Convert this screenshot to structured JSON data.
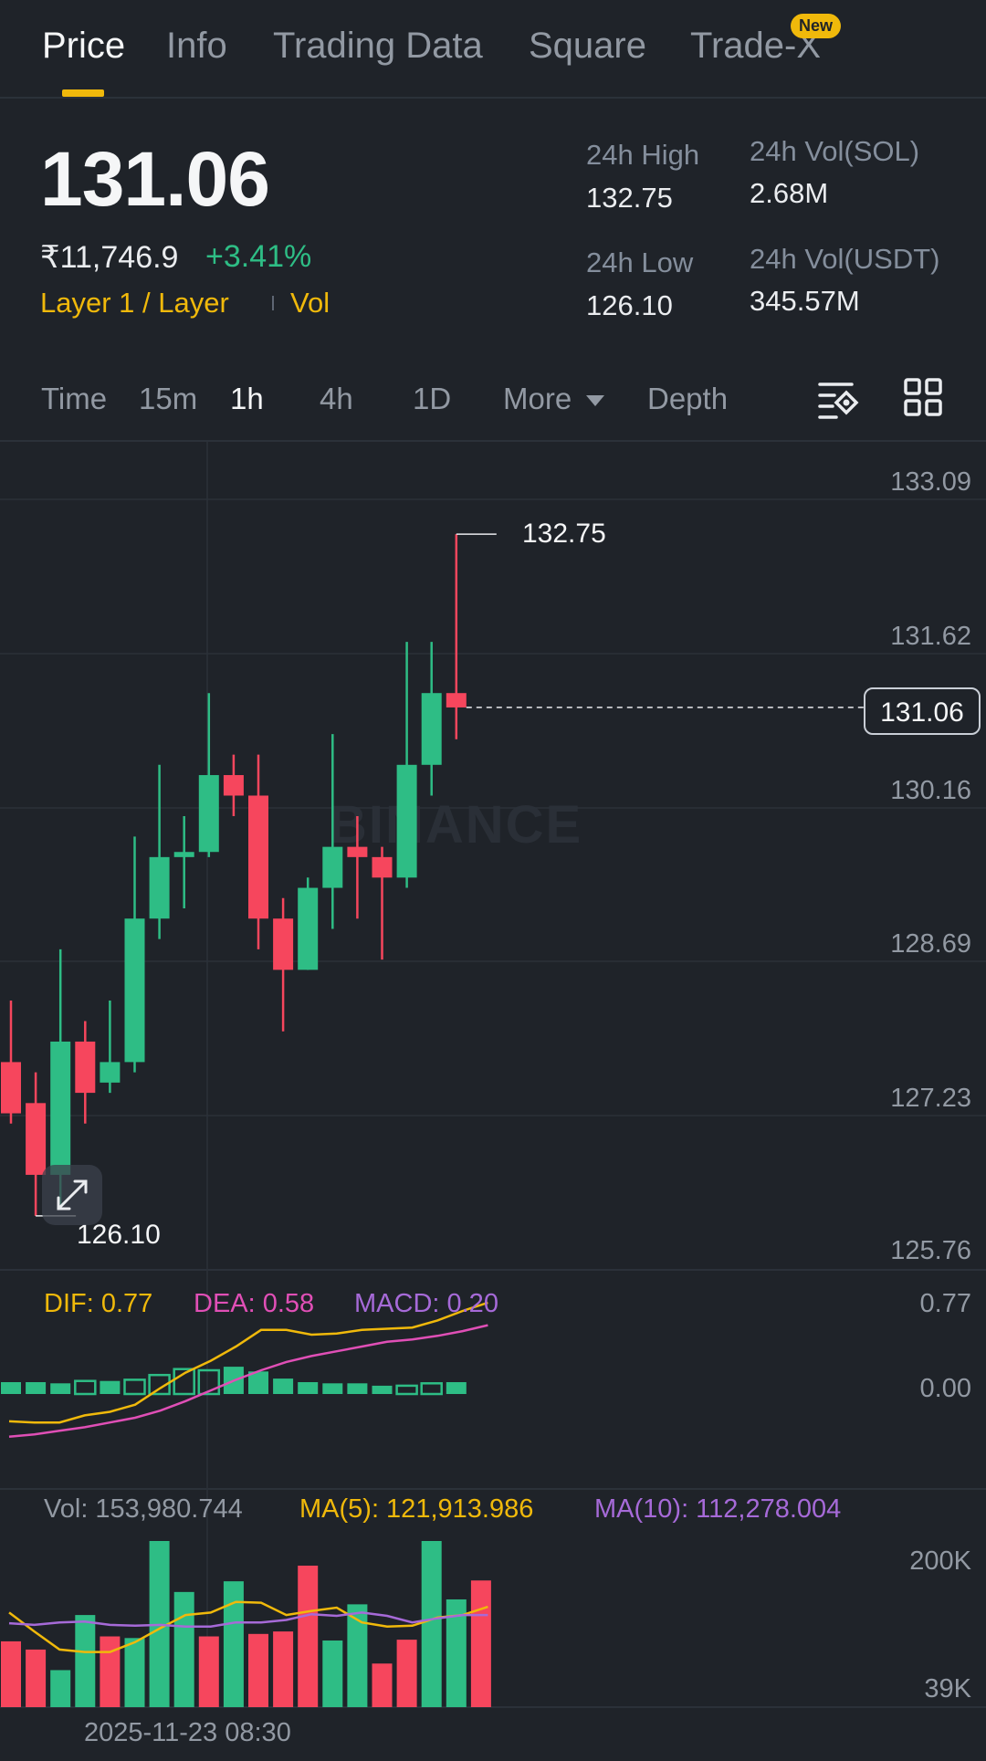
{
  "tabs": [
    {
      "label": "Price",
      "active": true
    },
    {
      "label": "Info",
      "active": false
    },
    {
      "label": "Trading Data",
      "active": false
    },
    {
      "label": "Square",
      "active": false
    },
    {
      "label": "Trade-X",
      "active": false,
      "badge": "New"
    }
  ],
  "summary": {
    "last_price": "131.06",
    "fiat_price": "₹11,746.9",
    "change_pct": "+3.41%",
    "tag_category": "Layer 1 / Layer",
    "tag_vol": "Vol"
  },
  "stats": {
    "high_label": "24h High",
    "high_value": "132.75",
    "low_label": "24h Low",
    "low_value": "126.10",
    "vol_base_label": "24h Vol(SOL)",
    "vol_base_value": "2.68M",
    "vol_quote_label": "24h Vol(USDT)",
    "vol_quote_value": "345.57M"
  },
  "timeframes": {
    "items": [
      "Time",
      "15m",
      "1h",
      "4h",
      "1D"
    ],
    "active": "1h",
    "more_label": "More",
    "depth_label": "Depth"
  },
  "icons": {
    "chart_settings": "chart-settings-icon",
    "layout_grid": "grid-layout-icon",
    "expand": "expand-icon",
    "more_caret": "caret-down-icon"
  },
  "colors": {
    "background": "#1f2329",
    "up": "#2ebd85",
    "down": "#f6465d",
    "accent": "#f0b90b",
    "dea": "#e04fb6",
    "macd": "#a66ad8"
  },
  "watermark": "BINANCE",
  "chart_data": [
    {
      "type": "candlestick",
      "y_ticks": [
        "133.09",
        "131.62",
        "130.16",
        "128.69",
        "127.23",
        "125.76"
      ],
      "ylim": [
        125.76,
        133.09
      ],
      "current_price_label": "131.06",
      "current_price": 131.06,
      "high_marker": {
        "label": "132.75",
        "value": 132.75
      },
      "low_marker": {
        "label": "126.10",
        "value": 126.1
      },
      "candles": [
        {
          "o": 127.6,
          "h": 128.2,
          "l": 127.0,
          "c": 127.1
        },
        {
          "o": 127.2,
          "h": 127.5,
          "l": 126.1,
          "c": 126.5
        },
        {
          "o": 126.5,
          "h": 128.7,
          "l": 126.2,
          "c": 127.8
        },
        {
          "o": 127.8,
          "h": 128.0,
          "l": 127.0,
          "c": 127.3
        },
        {
          "o": 127.4,
          "h": 128.2,
          "l": 127.3,
          "c": 127.6
        },
        {
          "o": 127.6,
          "h": 129.8,
          "l": 127.5,
          "c": 129.0
        },
        {
          "o": 129.0,
          "h": 130.5,
          "l": 128.8,
          "c": 129.6
        },
        {
          "o": 129.6,
          "h": 130.0,
          "l": 129.1,
          "c": 129.65
        },
        {
          "o": 129.65,
          "h": 131.2,
          "l": 129.6,
          "c": 130.4
        },
        {
          "o": 130.4,
          "h": 130.6,
          "l": 130.0,
          "c": 130.2
        },
        {
          "o": 130.2,
          "h": 130.6,
          "l": 128.7,
          "c": 129.0
        },
        {
          "o": 129.0,
          "h": 129.2,
          "l": 127.9,
          "c": 128.5
        },
        {
          "o": 128.5,
          "h": 129.4,
          "l": 128.5,
          "c": 129.3
        },
        {
          "o": 129.3,
          "h": 130.8,
          "l": 128.9,
          "c": 129.7
        },
        {
          "o": 129.7,
          "h": 130.0,
          "l": 129.0,
          "c": 129.6
        },
        {
          "o": 129.6,
          "h": 129.7,
          "l": 128.6,
          "c": 129.4
        },
        {
          "o": 129.4,
          "h": 131.7,
          "l": 129.3,
          "c": 130.5
        },
        {
          "o": 130.5,
          "h": 131.7,
          "l": 130.2,
          "c": 131.2
        },
        {
          "o": 131.2,
          "h": 132.75,
          "l": 130.75,
          "c": 131.06
        }
      ]
    },
    {
      "type": "bar",
      "indicator": "MACD",
      "legend": {
        "dif": "DIF: 0.77",
        "dea": "DEA: 0.58",
        "macd": "MACD: 0.20"
      },
      "y_ticks": [
        "0.77",
        "0.00"
      ],
      "histogram": [
        0.1,
        0.1,
        0.09,
        0.11,
        0.11,
        0.12,
        0.16,
        0.21,
        0.2,
        0.23,
        0.19,
        0.13,
        0.1,
        0.09,
        0.09,
        0.07,
        0.07,
        0.09,
        0.1
      ],
      "histogram_hollow": [
        false,
        false,
        false,
        true,
        false,
        true,
        true,
        true,
        true,
        false,
        false,
        false,
        false,
        false,
        false,
        false,
        true,
        true,
        false
      ],
      "dif": [
        -0.23,
        -0.24,
        -0.24,
        -0.18,
        -0.15,
        -0.09,
        0.05,
        0.18,
        0.28,
        0.4,
        0.54,
        0.54,
        0.5,
        0.51,
        0.54,
        0.55,
        0.56,
        0.62,
        0.7,
        0.77
      ],
      "dea": [
        -0.36,
        -0.34,
        -0.31,
        -0.28,
        -0.24,
        -0.2,
        -0.14,
        -0.06,
        0.03,
        0.12,
        0.2,
        0.27,
        0.32,
        0.36,
        0.4,
        0.44,
        0.46,
        0.49,
        0.53,
        0.58
      ]
    },
    {
      "type": "bar",
      "indicator": "Volume",
      "legend": {
        "vol": "Vol: 153,980.744",
        "ma5": "MA(5): 121,913.986",
        "ma10": "MA(10): 112,278.004"
      },
      "y_ticks": [
        "200K",
        "39K"
      ],
      "x_label": "2025-11-23 08:30",
      "volumes": [
        80000,
        70000,
        45000,
        112000,
        86000,
        84000,
        202000,
        140000,
        86000,
        153000,
        89000,
        92000,
        172000,
        81000,
        125000,
        53000,
        82000,
        202000,
        131000,
        154000
      ],
      "vol_up": [
        false,
        false,
        true,
        true,
        false,
        true,
        true,
        true,
        false,
        true,
        false,
        false,
        false,
        true,
        true,
        false,
        false,
        true,
        true,
        false
      ],
      "ma5": [
        115000,
        92000,
        70000,
        67000,
        67000,
        79000,
        96000,
        112000,
        115000,
        128000,
        127000,
        112000,
        117000,
        121000,
        103000,
        98000,
        99000,
        109000,
        112000,
        122000
      ],
      "ma10": [
        102000,
        100000,
        103000,
        104000,
        100000,
        99000,
        100000,
        98000,
        98000,
        103000,
        103000,
        106000,
        113000,
        111000,
        115000,
        111000,
        103000,
        108000,
        112000,
        112000
      ]
    }
  ]
}
